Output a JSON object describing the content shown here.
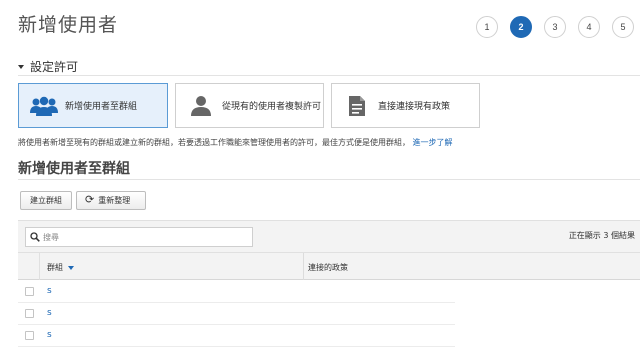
{
  "header": {
    "title": "新增使用者"
  },
  "steps": [
    "1",
    "2",
    "3",
    "4",
    "5"
  ],
  "active_step": "2",
  "permissions": {
    "section_title": "設定許可",
    "options": [
      {
        "label": "新增使用者至群組",
        "icon": "users-group-icon",
        "selected": true
      },
      {
        "label": "從現有的使用者複製許可",
        "icon": "user-icon",
        "selected": false
      },
      {
        "label": "直接連接現有政策",
        "icon": "document-icon",
        "selected": false
      }
    ],
    "description": "將使用者新增至現有的群組或建立新的群組，若要透過工作職能來管理使用者的許可，最佳方式便是使用群組，",
    "learn_more": "進一步了解"
  },
  "groups": {
    "title": "新增使用者至群組",
    "create_button": "建立群組",
    "refresh_button": "重新整理",
    "search_placeholder": "搜尋",
    "results_text": "正在顯示 3 個結果",
    "columns": {
      "group": "群組",
      "policy": "連接的政策"
    },
    "rows": [
      {
        "name": "s"
      },
      {
        "name": "s"
      },
      {
        "name": "s"
      }
    ]
  },
  "colors": {
    "accent": "#1f69b5",
    "selected_bg": "#e6f0fb",
    "icon_gray": "#666666"
  }
}
